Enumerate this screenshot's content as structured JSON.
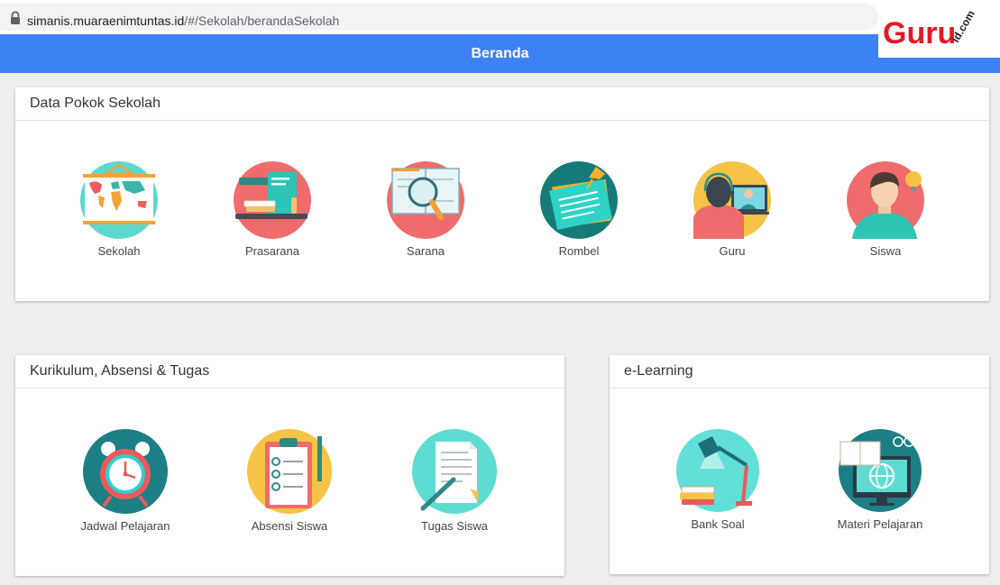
{
  "browser": {
    "url_host": "simanis.muaraenimtuntas.id",
    "url_path": "/#/Sekolah/berandaSekolah"
  },
  "logo": {
    "main": "Guru",
    "sub": "id.com"
  },
  "header": {
    "title": "Beranda"
  },
  "data_pokok": {
    "title": "Data Pokok Sekolah",
    "items": [
      {
        "label": "Sekolah",
        "icon": "world-map-icon"
      },
      {
        "label": "Prasarana",
        "icon": "laptop-books-icon"
      },
      {
        "label": "Sarana",
        "icon": "book-magnifier-icon"
      },
      {
        "label": "Rombel",
        "icon": "pinned-notes-icon"
      },
      {
        "label": "Guru",
        "icon": "video-call-icon"
      },
      {
        "label": "Siswa",
        "icon": "student-idea-icon"
      }
    ]
  },
  "kurikulum": {
    "title": "Kurikulum, Absensi & Tugas",
    "items": [
      {
        "label": "Jadwal Pelajaran",
        "icon": "alarm-clock-icon"
      },
      {
        "label": "Absensi Siswa",
        "icon": "clipboard-checklist-icon"
      },
      {
        "label": "Tugas Siswa",
        "icon": "document-pencil-icon"
      }
    ]
  },
  "elearning": {
    "title": "e-Learning",
    "items": [
      {
        "label": "Bank Soal",
        "icon": "desk-lamp-icon"
      },
      {
        "label": "Materi Pelajaran",
        "icon": "monitor-globe-icon"
      }
    ]
  }
}
